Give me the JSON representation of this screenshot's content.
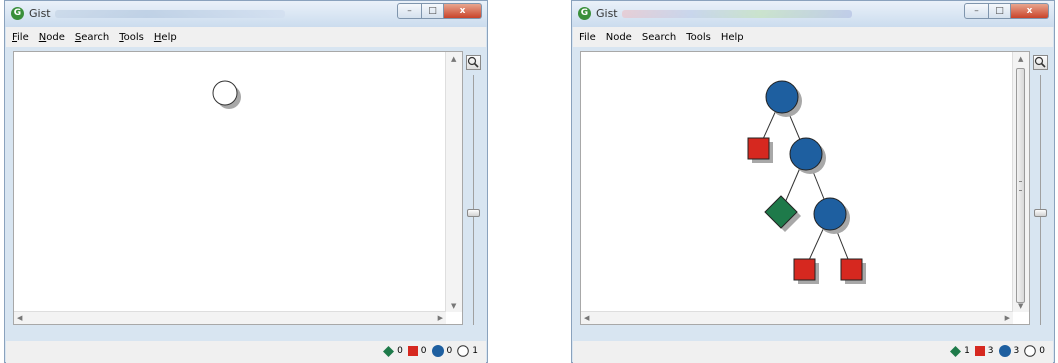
{
  "app_title": "Gist",
  "menu": [
    "File",
    "Node",
    "Search",
    "Tools",
    "Help"
  ],
  "window_controls": {
    "minimize": "–",
    "maximize": "□",
    "close": "x"
  },
  "zoom_icon": "magnifier-icon",
  "node_types": [
    {
      "key": "failed",
      "shape": "diamond",
      "color": "#1e7a4a"
    },
    {
      "key": "solved",
      "shape": "square",
      "color": "#d6281f"
    },
    {
      "key": "branch",
      "shape": "circle",
      "color": "#1e5fa0"
    },
    {
      "key": "unexplored",
      "shape": "circle",
      "color": "#ffffff"
    }
  ],
  "left_window": {
    "legend_counts": [
      "0",
      "0",
      "0",
      "1"
    ],
    "zoom_level": 0.55
  },
  "right_window": {
    "legend_counts": [
      "1",
      "3",
      "3",
      "0"
    ],
    "zoom_level": 0.55
  }
}
